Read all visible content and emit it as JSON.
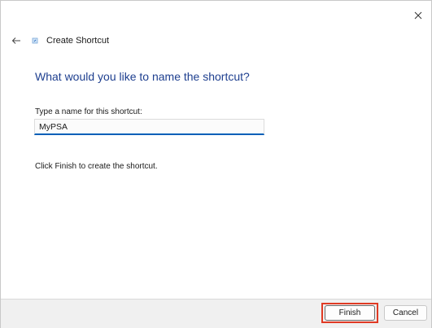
{
  "window": {
    "close_icon": "close-icon"
  },
  "header": {
    "back_icon": "back-arrow-icon",
    "wizard_icon": "shortcut-wizard-icon",
    "title": "Create Shortcut"
  },
  "main": {
    "heading": "What would you like to name the shortcut?",
    "field_label": "Type a name for this shortcut:",
    "name_value": "MyPSA",
    "instruction": "Click Finish to create the shortcut."
  },
  "footer": {
    "finish_label": "Finish",
    "cancel_label": "Cancel"
  },
  "colors": {
    "heading": "#1e3f8f",
    "input_underline": "#005fb8",
    "highlight": "#e03a24"
  }
}
